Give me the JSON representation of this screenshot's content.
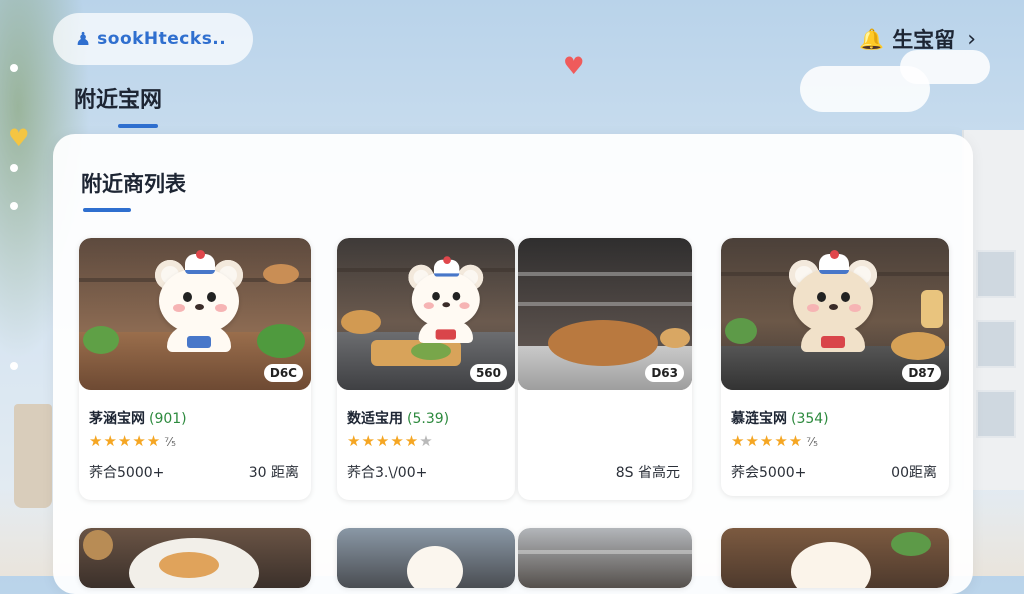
{
  "header": {
    "account_icon": "person-icon",
    "account_name": "sookHtecks..",
    "notify_icon": "bell-icon",
    "notify_label": "生宝留",
    "chevron": "›"
  },
  "page": {
    "title": "附近宝网"
  },
  "panel": {
    "title": "附近商列表"
  },
  "colors": {
    "accent": "#2f6fcf",
    "star": "#f5a623",
    "score": "#2d8a3e"
  },
  "cards": [
    {
      "name": "茅涵宝网",
      "score": "(901)",
      "stars": "★★★★★",
      "stars_dim": "",
      "stars_extra": "⁷⁄₅",
      "price": "D6C",
      "left_meta": "荞合5000+",
      "right_meta": "30 距离"
    },
    {
      "name": "数适宝用",
      "score": "(5.39)",
      "stars": "★★★★★",
      "stars_dim": "★",
      "stars_extra": "",
      "price": "560",
      "left_meta": "荞合3.\\/00+",
      "right_meta": ""
    },
    {
      "name": "",
      "score": "",
      "stars": "",
      "stars_dim": "",
      "stars_extra": "",
      "price": "D63",
      "left_meta": "",
      "right_meta": "8S 省高元"
    },
    {
      "name": "慕涟宝网",
      "score": "(354)",
      "stars": "★★★★★",
      "stars_dim": "",
      "stars_extra": "⁷⁄₅",
      "price": "D87",
      "left_meta": "荞会5000+",
      "right_meta": "00距离"
    }
  ]
}
